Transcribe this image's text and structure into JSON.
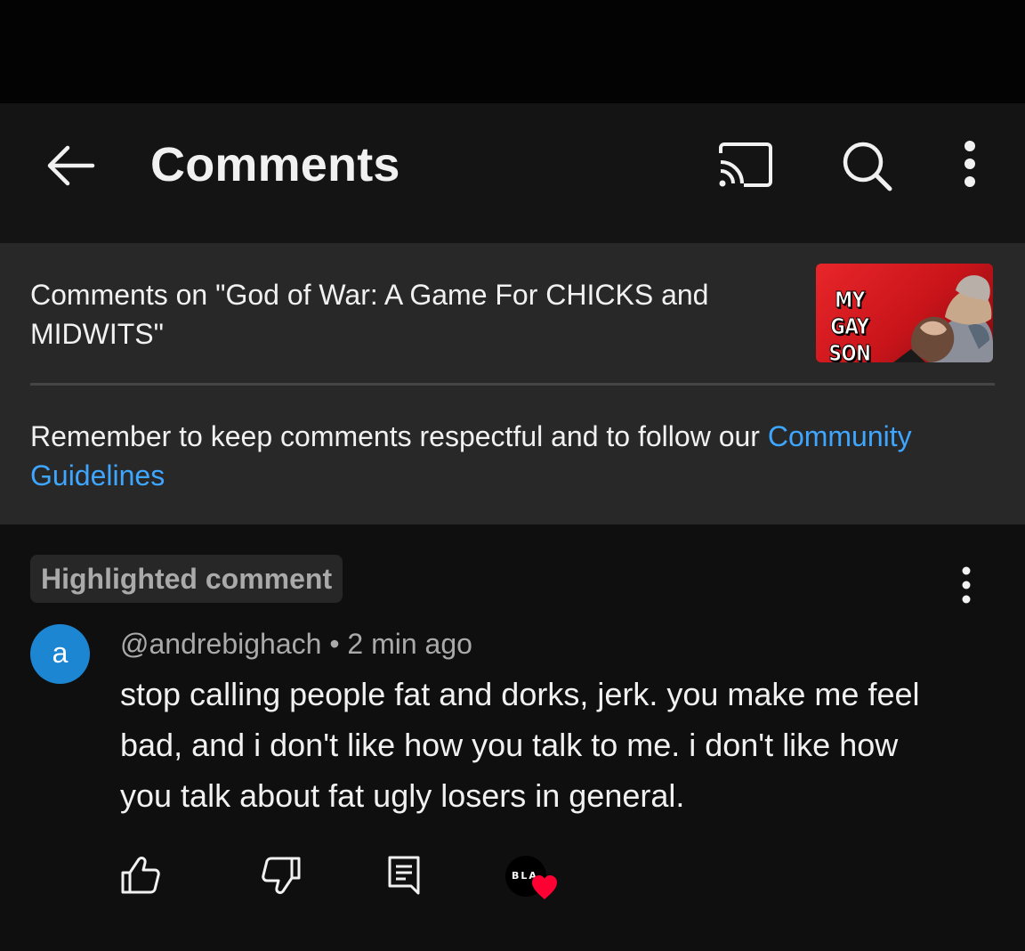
{
  "app_bar": {
    "title": "Comments",
    "icons": [
      "back-arrow-icon",
      "cast-icon",
      "search-icon",
      "more-vert-icon"
    ]
  },
  "video": {
    "title": "Comments on \"God of War: A Game For CHICKS and MIDWITS\"",
    "thumbnail_text": "MY GAY SON"
  },
  "guidelines": {
    "text": "Remember to keep comments respectful and to follow our ",
    "link": "Community Guidelines"
  },
  "comment": {
    "badge": "Highlighted comment",
    "avatar_letter": "a",
    "author": "@andrebighach",
    "separator": " • ",
    "time": "2 min ago",
    "text": "stop calling people fat and dorks, jerk. you make me feel bad, and i don't like how you talk to me. i  don't like how you talk about fat ugly losers in general.",
    "creator_avatar_text": "BLA",
    "actions": [
      "thumb-up-icon",
      "thumb-down-icon",
      "reply-icon",
      "creator-heart-icon"
    ]
  },
  "colors": {
    "background": "#0f0f0f",
    "app_bar": "#141414",
    "panel": "#282828",
    "link": "#3ea6ff",
    "avatar": "#1c86d2",
    "heart": "#ff0033",
    "secondary_text": "#aaaaaa"
  }
}
